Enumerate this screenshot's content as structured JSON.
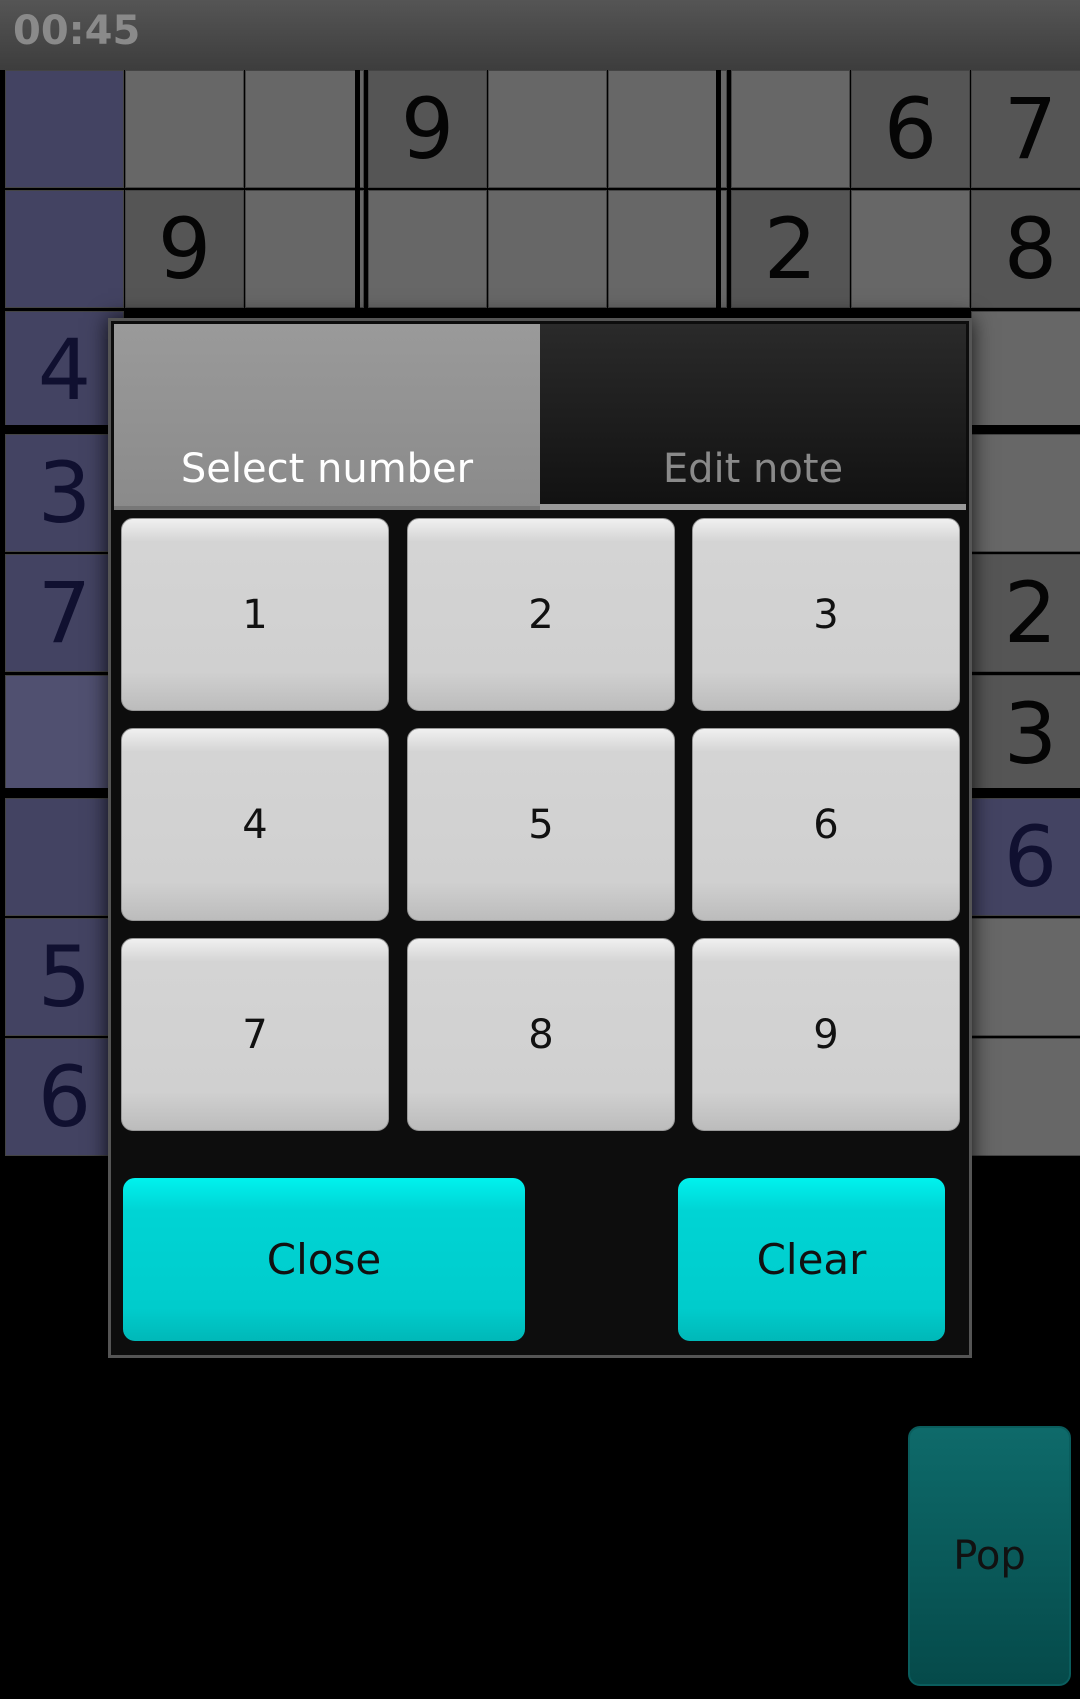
{
  "status": {
    "timer": "00:45"
  },
  "board": {
    "colors": {
      "normal": "#676767",
      "given": "#555555",
      "highlight": "#434362",
      "highlight_light": "#505070"
    },
    "cells": [
      {
        "r": 0,
        "c": 0,
        "v": "",
        "t": "hl"
      },
      {
        "r": 0,
        "c": 1,
        "v": "",
        "t": "n"
      },
      {
        "r": 0,
        "c": 2,
        "v": "",
        "t": "n"
      },
      {
        "r": 0,
        "c": 3,
        "v": "9",
        "t": "g"
      },
      {
        "r": 0,
        "c": 4,
        "v": "",
        "t": "n"
      },
      {
        "r": 0,
        "c": 5,
        "v": "",
        "t": "n"
      },
      {
        "r": 0,
        "c": 6,
        "v": "",
        "t": "n"
      },
      {
        "r": 0,
        "c": 7,
        "v": "6",
        "t": "g"
      },
      {
        "r": 0,
        "c": 8,
        "v": "7",
        "t": "g"
      },
      {
        "r": 1,
        "c": 0,
        "v": "",
        "t": "hl"
      },
      {
        "r": 1,
        "c": 1,
        "v": "9",
        "t": "g"
      },
      {
        "r": 1,
        "c": 2,
        "v": "",
        "t": "n"
      },
      {
        "r": 1,
        "c": 3,
        "v": "",
        "t": "n"
      },
      {
        "r": 1,
        "c": 4,
        "v": "",
        "t": "n"
      },
      {
        "r": 1,
        "c": 5,
        "v": "",
        "t": "n"
      },
      {
        "r": 1,
        "c": 6,
        "v": "2",
        "t": "g"
      },
      {
        "r": 1,
        "c": 7,
        "v": "",
        "t": "n"
      },
      {
        "r": 1,
        "c": 8,
        "v": "8",
        "t": "g"
      },
      {
        "r": 2,
        "c": 0,
        "v": "4",
        "t": "hl"
      },
      {
        "r": 2,
        "c": 8,
        "v": "",
        "t": "n"
      },
      {
        "r": 3,
        "c": 0,
        "v": "3",
        "t": "hl"
      },
      {
        "r": 3,
        "c": 8,
        "v": "",
        "t": "n"
      },
      {
        "r": 4,
        "c": 0,
        "v": "7",
        "t": "hl"
      },
      {
        "r": 4,
        "c": 8,
        "v": "2",
        "t": "g"
      },
      {
        "r": 5,
        "c": 0,
        "v": "",
        "t": "hll"
      },
      {
        "r": 5,
        "c": 8,
        "v": "3",
        "t": "g"
      },
      {
        "r": 6,
        "c": 0,
        "v": "",
        "t": "hl"
      },
      {
        "r": 6,
        "c": 8,
        "v": "6",
        "t": "hl"
      },
      {
        "r": 7,
        "c": 0,
        "v": "5",
        "t": "hl"
      },
      {
        "r": 7,
        "c": 8,
        "v": "",
        "t": "n"
      },
      {
        "r": 8,
        "c": 0,
        "v": "6",
        "t": "hl"
      },
      {
        "r": 8,
        "c": 8,
        "v": "",
        "t": "n"
      }
    ]
  },
  "dialog": {
    "tabs": [
      {
        "label": "Select number",
        "active": true
      },
      {
        "label": "Edit note",
        "active": false
      }
    ],
    "numbers": [
      "1",
      "2",
      "3",
      "4",
      "5",
      "6",
      "7",
      "8",
      "9"
    ],
    "close_label": "Close",
    "clear_label": "Clear"
  },
  "pop_label": "Pop"
}
